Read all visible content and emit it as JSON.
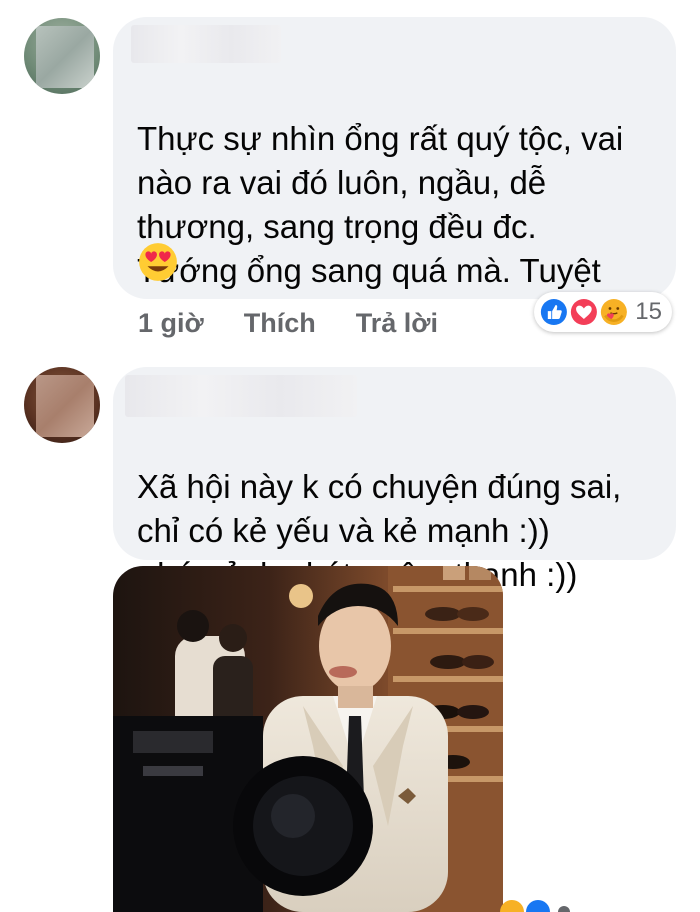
{
  "comments": [
    {
      "text": "Thực sự nhìn ổng rất quý tộc, vai\nnào ra vai đó luôn, ngầu, dễ\nthương, sang trọng đều đc.\nTướng ổng sang quá mà. Tuyệt",
      "emoji": "heart-eyes-emoji",
      "time": "1 giờ",
      "like_label": "Thích",
      "reply_label": "Trả lời",
      "reaction_count": "15",
      "reactions": [
        "like",
        "love",
        "care"
      ]
    },
    {
      "text": "Xã hội này k có chuyện đúng sai,\nchỉ có kẻ yếu và kẻ mạnh :))\n- bức ảnh phát ra âm thanh :))",
      "attachment": "photo"
    }
  ],
  "colors": {
    "bubble": "#f0f2f5",
    "meta": "#65676b",
    "like_blue": "#1877f2",
    "love_red": "#f33e58",
    "care_yellow": "#f7b125"
  }
}
